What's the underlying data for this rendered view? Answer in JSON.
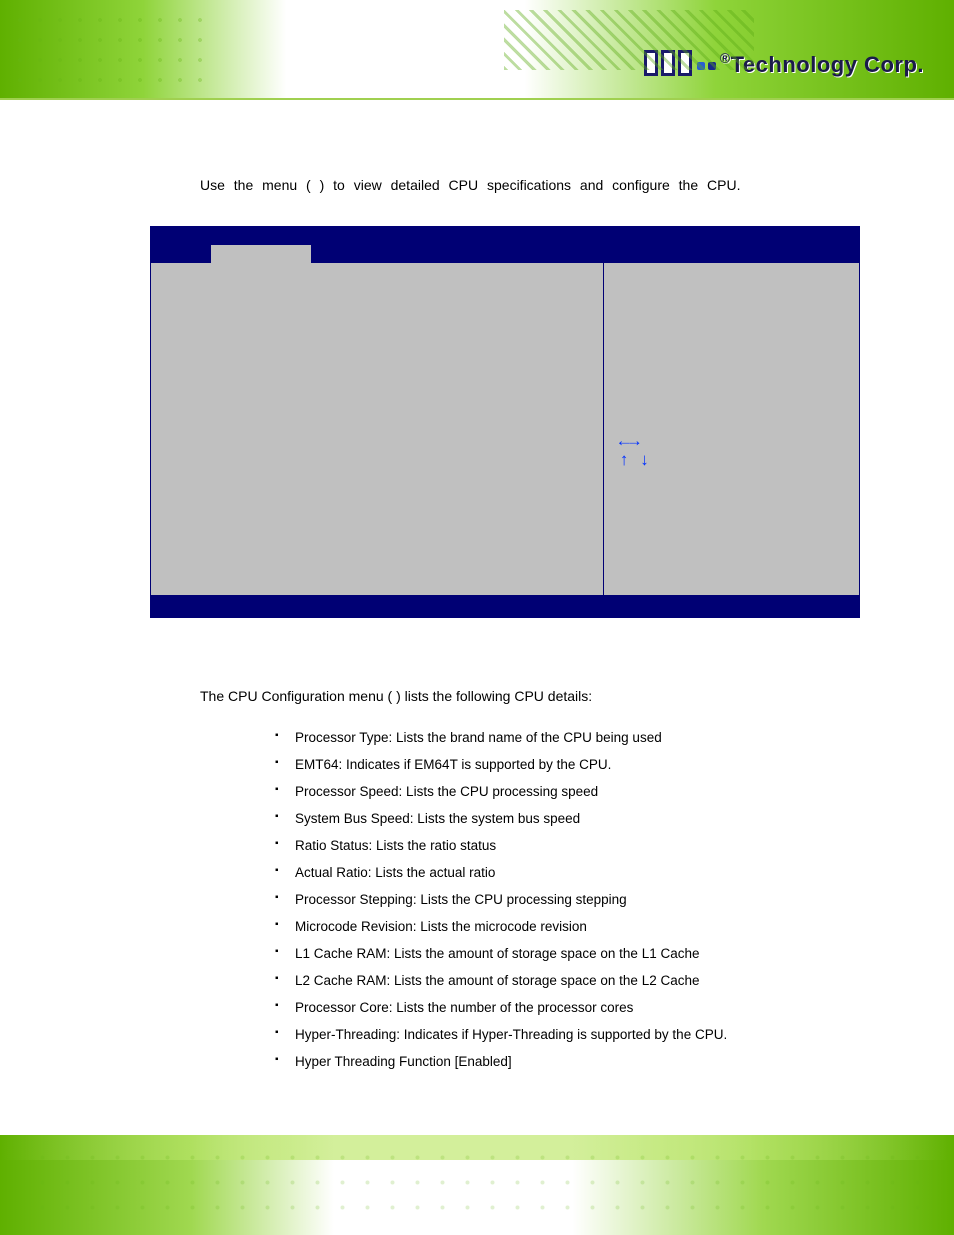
{
  "brand": {
    "r_mark": "®",
    "name": "Technology Corp."
  },
  "intro": {
    "line": "Use the                                   menu (                    ) to view detailed CPU specifications and configure the CPU."
  },
  "bios_nav": {
    "arrows_lr": "←→",
    "arrows_ud": "↑ ↓"
  },
  "after": {
    "intro": "The CPU Configuration menu (                        ) lists the following CPU details:",
    "items": [
      "Processor Type: Lists the brand name of the CPU being used",
      "EMT64: Indicates if EM64T is supported by the CPU.",
      "Processor Speed: Lists the CPU processing speed",
      "System Bus Speed: Lists the system bus speed",
      "Ratio Status: Lists the ratio status",
      "Actual Ratio: Lists the actual ratio",
      "Processor Stepping: Lists the CPU processing stepping",
      "Microcode Revision: Lists the microcode revision",
      "L1 Cache RAM: Lists the amount of storage space on the L1 Cache",
      "L2 Cache RAM: Lists the amount of storage space on the L2 Cache",
      "Processor Core: Lists the number of the processor cores",
      "Hyper-Threading: Indicates if Hyper-Threading is supported by the CPU.",
      "Hyper Threading Function [Enabled]"
    ]
  }
}
